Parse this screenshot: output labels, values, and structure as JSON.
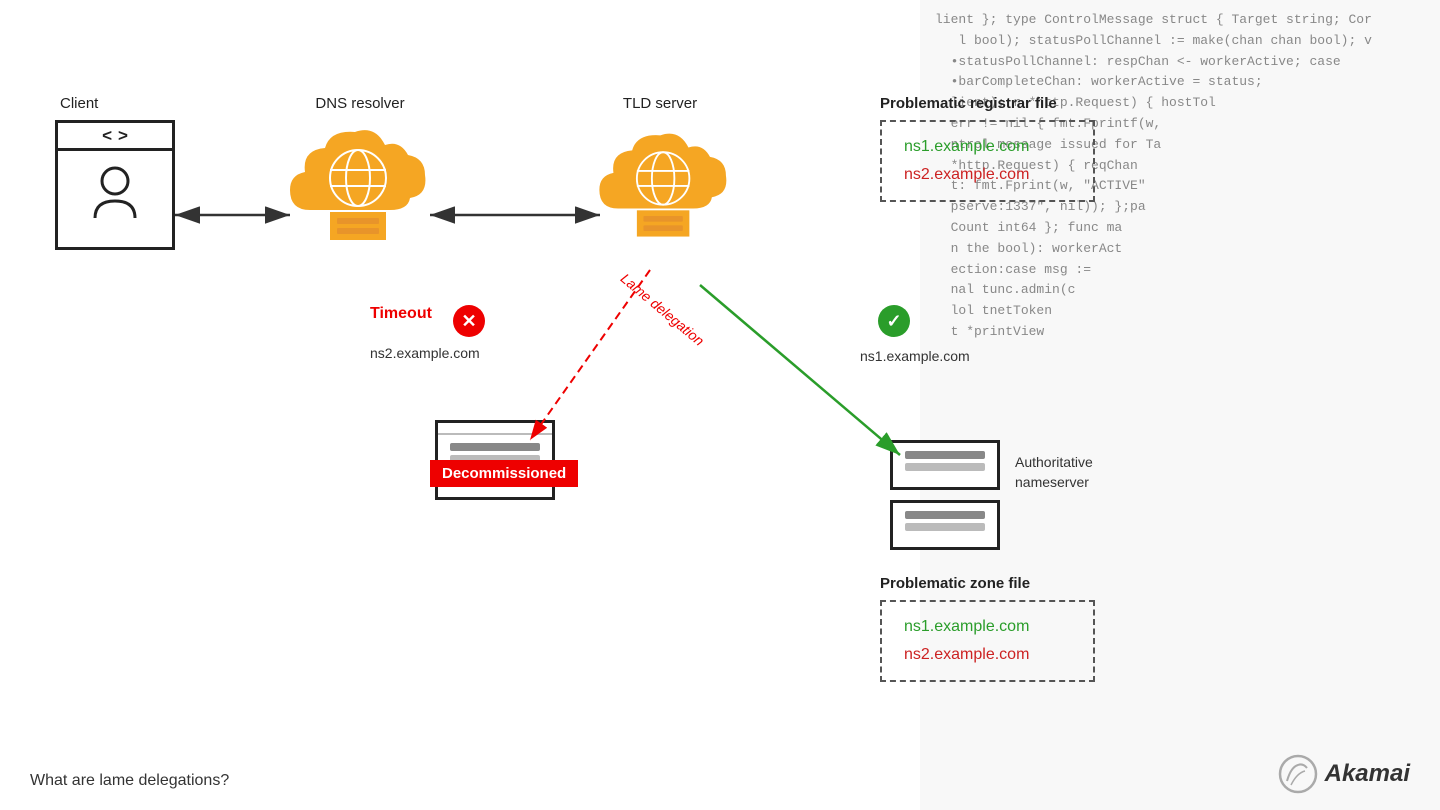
{
  "code_bg": {
    "lines": [
      "lient }; type ControlMessage struct { Target string; Cor",
      "l bool); statusPollChannel := make(chan chan bool); v",
      "statuePollChannel: respChan <- workerActive; case",
      "barCompleteChan: workerActive = status;",
      "lient); r *http.Request) { hostTol",
      "err != nil { fmt.Fprintf(w,",
      "ntrol message issued for Ta",
      "*http.Request) { reqChan",
      "t: fmt.Fprint(w, \"ACTIVE\"",
      "pserve:1337\", nil)); };pa",
      "Count int64 }; func ma",
      "n the bool): workerAct",
      "ection:case msg :=",
      "nal tunc.admin(c",
      "lol tnetToken",
      "t *printView",
      ""
    ]
  },
  "nodes": {
    "client_label": "Client",
    "dns_label": "DNS resolver",
    "tld_label": "TLD server"
  },
  "files": {
    "registrar_title": "Problematic registrar file",
    "registrar_line1": "ns1.example.com",
    "registrar_line2": "ns2.example.com",
    "zone_title": "Problematic zone file",
    "zone_line1": "ns1.example.com",
    "zone_line2": "ns2.example.com"
  },
  "labels": {
    "timeout": "Timeout",
    "lame": "Lame delegation",
    "decommissioned": "Decommissioned",
    "ns2": "ns2.example.com",
    "ns1": "ns1.example.com",
    "auth_ns_line1": "Authoritative",
    "auth_ns_line2": "nameserver",
    "bottom_text": "What are lame delegations?",
    "check_mark": "✓",
    "x_mark": "✕"
  },
  "akamai": {
    "text": "Akamai"
  }
}
